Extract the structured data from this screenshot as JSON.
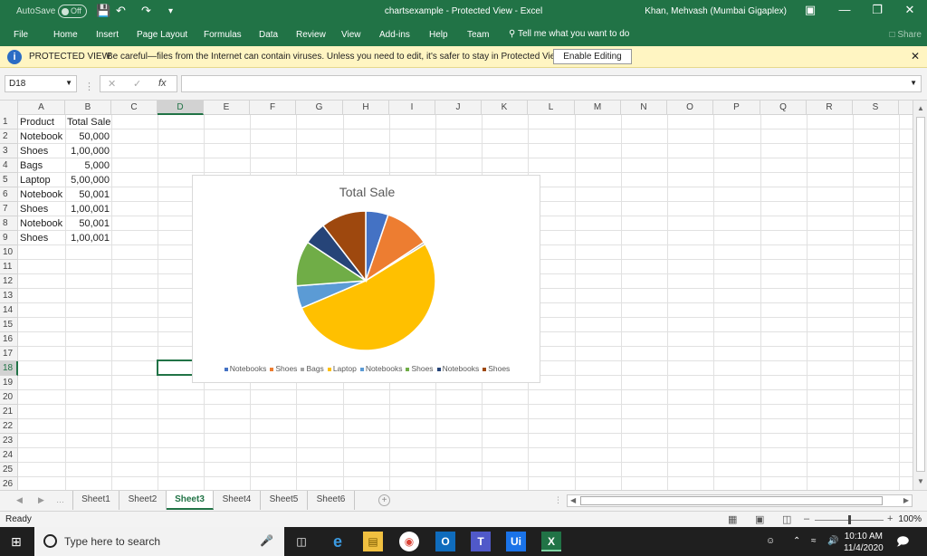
{
  "titlebar": {
    "autosave_label": "AutoSave",
    "autosave_state": "Off",
    "title": "chartsexample  -  Protected View  -  Excel",
    "user": "Khan, Mehvash (Mumbai Gigaplex)",
    "accent": "#217346"
  },
  "ribbon": {
    "tabs": [
      "File",
      "Home",
      "Insert",
      "Page Layout",
      "Formulas",
      "Data",
      "Review",
      "View",
      "Add-ins",
      "Help",
      "Team"
    ],
    "tell_me": "Tell me what you want to do",
    "share": "Share"
  },
  "protected_bar": {
    "label": "PROTECTED VIEW",
    "message": "Be careful—files from the Internet can contain viruses. Unless you need to edit, it's safer to stay in Protected View.",
    "button": "Enable Editing"
  },
  "formula_bar": {
    "name_box": "D18",
    "fx": "fx",
    "formula": ""
  },
  "grid": {
    "columns": [
      "A",
      "B",
      "C",
      "D",
      "E",
      "F",
      "G",
      "H",
      "I",
      "J",
      "K",
      "L",
      "M",
      "N",
      "O",
      "P",
      "Q",
      "R",
      "S"
    ],
    "rows": [
      "1",
      "2",
      "3",
      "4",
      "5",
      "6",
      "7",
      "8",
      "9",
      "10",
      "11",
      "12",
      "13",
      "14",
      "15",
      "16",
      "17",
      "18",
      "19",
      "20",
      "21",
      "22",
      "23",
      "24",
      "25",
      "26"
    ],
    "headers": [
      "Product",
      "Total Sale"
    ],
    "data": [
      [
        "Notebook",
        "50,000"
      ],
      [
        "Shoes",
        "1,00,000"
      ],
      [
        "Bags",
        "5,000"
      ],
      [
        "Laptop",
        "5,00,000"
      ],
      [
        "Notebook",
        "50,001"
      ],
      [
        "Shoes",
        "1,00,001"
      ],
      [
        "Notebook",
        "50,001"
      ],
      [
        "Shoes",
        "1,00,001"
      ]
    ],
    "active_cell": "D18"
  },
  "chart_data": {
    "type": "pie",
    "title": "Total Sale",
    "categories": [
      "Notebooks",
      "Shoes",
      "Bags",
      "Laptop",
      "Notebooks",
      "Shoes",
      "Notebooks",
      "Shoes"
    ],
    "values": [
      50000,
      100000,
      5000,
      500000,
      50001,
      100001,
      50001,
      100001
    ],
    "visible_slices_degrees_note": "",
    "colors": [
      "#4472c4",
      "#ed7d31",
      "#a5a5a5",
      "#ffc000",
      "#5b9bd5",
      "#70ad47",
      "#264478",
      "#9e480e"
    ],
    "legend_position": "bottom"
  },
  "sheets": {
    "tabs": [
      "Sheet1",
      "Sheet2",
      "Sheet3",
      "Sheet4",
      "Sheet5",
      "Sheet6"
    ],
    "active": "Sheet3"
  },
  "status": {
    "ready": "Ready",
    "zoom": "100%"
  },
  "taskbar": {
    "search_placeholder": "Type here to search",
    "time": "10:10 AM",
    "date": "11/4/2020"
  }
}
